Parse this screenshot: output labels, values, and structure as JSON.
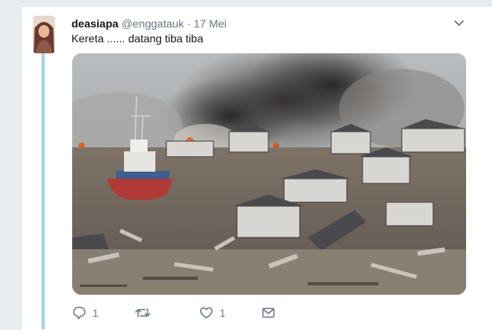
{
  "tweet": {
    "display_name": "deasiapa",
    "handle": "@enggatauk",
    "separator": " · ",
    "date": "17 Mei",
    "text": "Kereta ...... datang tiba tiba",
    "menu_icon": "chevron-down-icon",
    "media": {
      "subject": "photo of a town destroyed by a tsunami with a stranded fishing ship and smoke"
    },
    "actions": {
      "reply_count": "1",
      "retweet_count": "",
      "like_count": "1"
    }
  },
  "colors": {
    "thread_line": "#a9d2f0",
    "text_primary": "#14171a",
    "text_secondary": "#657786",
    "background": "#e6ecf0"
  }
}
